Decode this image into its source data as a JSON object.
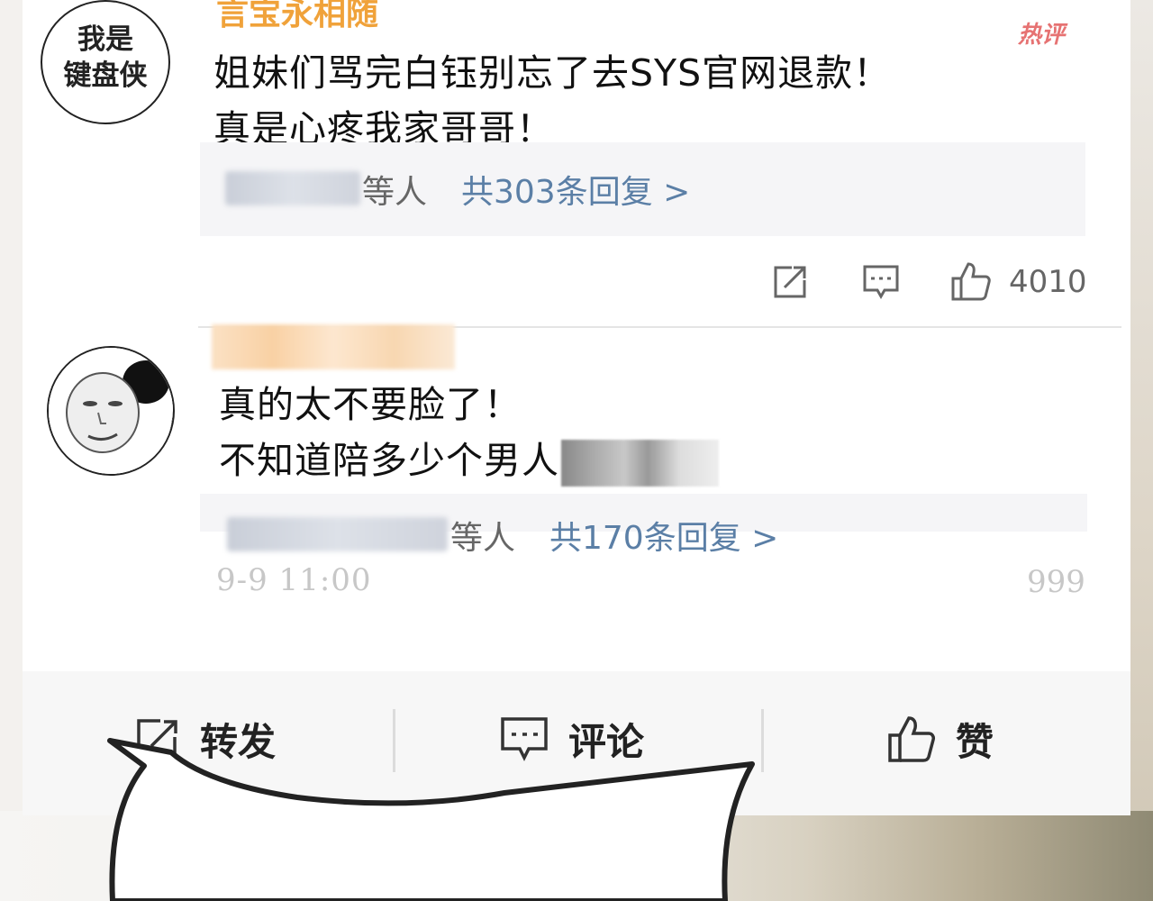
{
  "comments": [
    {
      "avatar_text_line1": "我是",
      "avatar_text_line2": "键盘侠",
      "username": "言宝永相随",
      "hot_badge": "热评",
      "content_line1": "姐妹们骂完白钰别忘了去SYS官网退款！",
      "content_line2": "真是心疼我家哥哥！",
      "reply_etc": "等人",
      "reply_count": "共303条回复 >",
      "like_count": "4010"
    },
    {
      "content_line1": "真的太不要脸了！",
      "content_line2": "不知道陪多少个男人",
      "reply_etc": "等人",
      "reply_count": "共170条回复 >",
      "timestamp": "9-9  11:00",
      "count": "999"
    }
  ],
  "bottom_bar": {
    "repost": "转发",
    "comment": "评论",
    "like": "赞"
  },
  "colors": {
    "username": "#f0a23a",
    "link": "#5b7fa6",
    "hot": "#e25a5a"
  }
}
